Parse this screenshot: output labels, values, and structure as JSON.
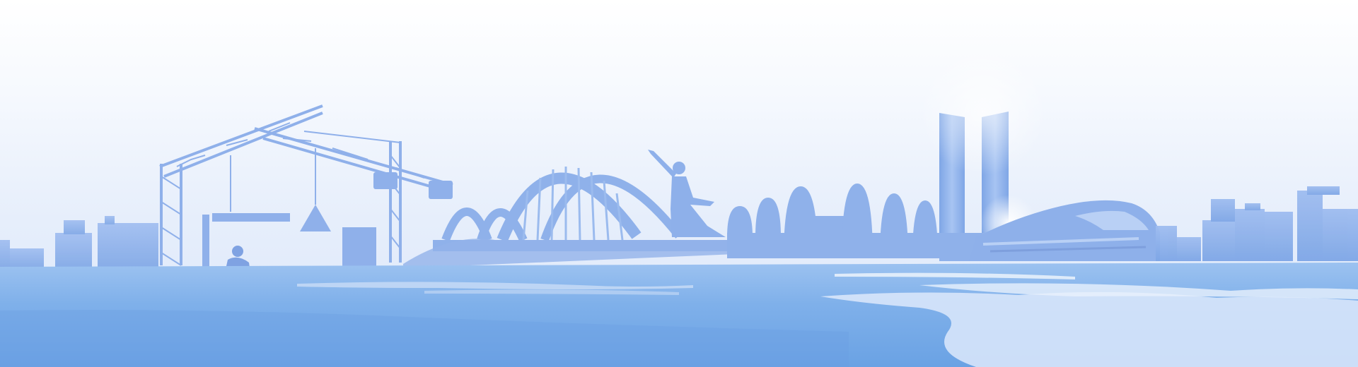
{
  "banner": {
    "colors": {
      "sky_top": "#ffffff",
      "sky_mid": "#eef3fd",
      "sky_low": "#dde8fa",
      "silhouette": "#8aaee8",
      "silhouette_dark": "#6f98de",
      "water": "#7fb0ea",
      "water_deep": "#5f95de",
      "highlight": "#ffffff"
    },
    "elements": [
      "city-skyline-left",
      "tower-crane",
      "construction-worker",
      "arch-bridge",
      "dancer-sculpture",
      "dome-buildings",
      "twin-towers",
      "high-speed-train",
      "city-skyline-right",
      "water-reflection"
    ]
  }
}
